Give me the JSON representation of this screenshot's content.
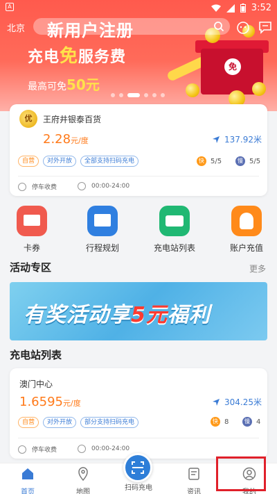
{
  "status_bar": {
    "left_icon": "a-app-icon",
    "time": "3:52"
  },
  "header": {
    "city": "北京",
    "search_icon": "search-icon",
    "robot_icon": "chatbot-icon",
    "message_icon": "message-icon"
  },
  "banner": {
    "title1": "新用户注册",
    "title2_pre": "充电",
    "title2_hl": "免",
    "title2_post": "服务费",
    "sub_pre": "最高可免",
    "sub_hl": "50元",
    "gift_label": "免"
  },
  "station1": {
    "medal": "优",
    "name": "王府井银泰百货",
    "price": "2.28",
    "price_unit": "元/度",
    "distance": "137.92米",
    "tags": [
      {
        "label": "自营",
        "color": "orange"
      },
      {
        "label": "对外开放",
        "color": "blue"
      },
      {
        "label": "全部支持扫码充电",
        "color": "blue"
      }
    ],
    "fast_label": "快",
    "fast_count": "5/5",
    "slow_label": "慢",
    "slow_count": "5/5",
    "parking": "停车收费",
    "hours": "00:00-24:00"
  },
  "quick_actions": [
    {
      "label": "卡券",
      "icon": "coupon-icon",
      "color": "#f05a4e"
    },
    {
      "label": "行程规划",
      "icon": "route-plan-icon",
      "color": "#2f7fe0"
    },
    {
      "label": "充电站列表",
      "icon": "station-list-icon",
      "color": "#20b873"
    },
    {
      "label": "账户充值",
      "icon": "recharge-icon",
      "color": "#ff8a1a"
    }
  ],
  "activity": {
    "title": "活动专区",
    "more": "更多",
    "promo_pre": "有奖活动享",
    "promo_hl": "5元",
    "promo_post": "福利"
  },
  "list_title": "充电站列表",
  "station2": {
    "name": "澳门中心",
    "price": "1.6595",
    "price_unit": "元/度",
    "distance": "304.25米",
    "tags": [
      {
        "label": "自营",
        "color": "orange"
      },
      {
        "label": "对外开放",
        "color": "blue"
      },
      {
        "label": "部分支持扫码充电",
        "color": "blue"
      }
    ],
    "fast_label": "快",
    "fast_count": "8",
    "slow_label": "慢",
    "slow_count": "4",
    "parking": "停车收费",
    "hours": "00:00-24:00"
  },
  "bottom_nav": [
    {
      "label": "首页",
      "icon": "home-icon"
    },
    {
      "label": "地图",
      "icon": "map-pin-icon"
    },
    {
      "label": "扫码充电",
      "icon": "scan-icon"
    },
    {
      "label": "资讯",
      "icon": "news-icon"
    },
    {
      "label": "我的",
      "icon": "profile-icon"
    }
  ],
  "colors": {
    "brand_red": "#ff5a4d",
    "accent_blue": "#3a7bd5",
    "price_orange": "#ff7a1a",
    "highlight_red": "#e0202a"
  }
}
